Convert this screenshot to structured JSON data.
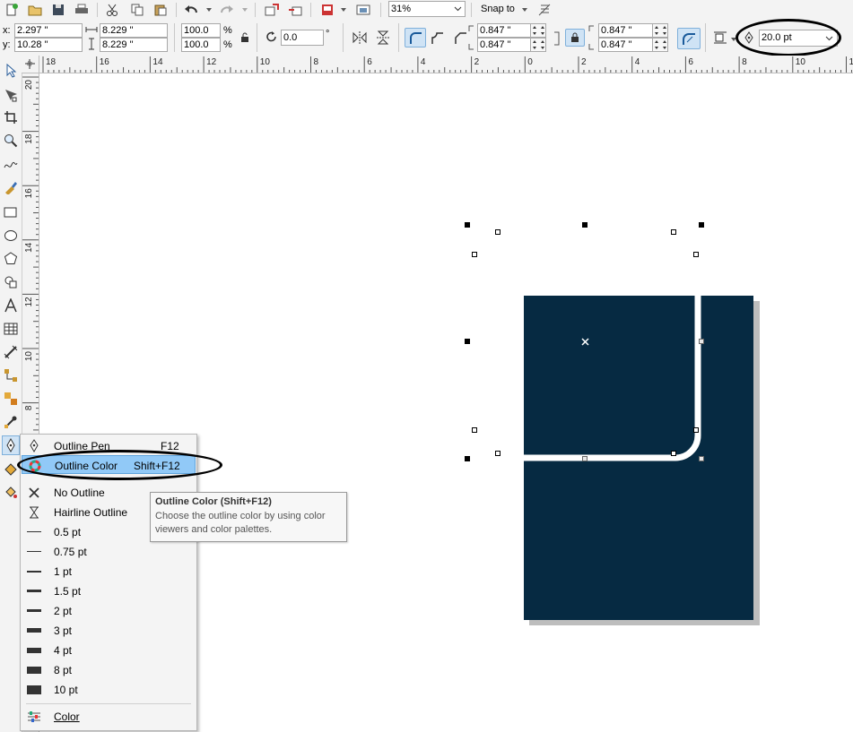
{
  "toolbar": {
    "zoom": "31%",
    "snap_to": "Snap to"
  },
  "property_bar": {
    "x_label": "x:",
    "x_value": "2.297 \"",
    "y_label": "y:",
    "y_value": "10.28 \"",
    "width_value": "8.229 \"",
    "height_value": "8.229 \"",
    "scale_x": "100.0",
    "scale_y": "100.0",
    "percent": "%",
    "rotation": "0.0",
    "degree": "°",
    "corner_tl": "0.847 \"",
    "corner_bl": "0.847 \"",
    "corner_tr": "0.847 \"",
    "corner_br": "0.847 \"",
    "outline_width": "20.0 pt"
  },
  "rulers": {
    "horizontal_ticks": [
      "18",
      "16",
      "14",
      "12",
      "10",
      "8",
      "6",
      "4",
      "2",
      "0",
      "2",
      "4",
      "6",
      "8",
      "10",
      "12"
    ],
    "vertical_ticks": [
      "20",
      "18",
      "16",
      "14",
      "12",
      "10",
      "8"
    ]
  },
  "flyout_menu": {
    "items": [
      {
        "label": "Outline Pen",
        "shortcut": "F12",
        "icon": "pen-nib-icon"
      },
      {
        "label": "Outline Color",
        "shortcut": "Shift+F12",
        "icon": "color-wheel-icon"
      },
      {
        "label": "No Outline",
        "shortcut": "",
        "icon": "x-icon"
      },
      {
        "label": "Hairline Outline",
        "shortcut": "",
        "icon": "hairline-icon"
      },
      {
        "label": "0.5 pt",
        "shortcut": "",
        "icon": "line-width-icon"
      },
      {
        "label": "0.75 pt",
        "shortcut": "",
        "icon": "line-width-icon"
      },
      {
        "label": "1 pt",
        "shortcut": "",
        "icon": "line-width-icon"
      },
      {
        "label": "1.5 pt",
        "shortcut": "",
        "icon": "line-width-icon"
      },
      {
        "label": "2 pt",
        "shortcut": "",
        "icon": "line-width-icon"
      },
      {
        "label": "3 pt",
        "shortcut": "",
        "icon": "line-width-icon"
      },
      {
        "label": "4 pt",
        "shortcut": "",
        "icon": "line-width-icon"
      },
      {
        "label": "8 pt",
        "shortcut": "",
        "icon": "line-width-icon"
      },
      {
        "label": "10 pt",
        "shortcut": "",
        "icon": "line-width-icon"
      },
      {
        "label": "Color",
        "shortcut": "",
        "icon": "color-settings-icon"
      }
    ],
    "highlighted_index": 1
  },
  "tooltip": {
    "title": "Outline Color (Shift+F12)",
    "line1": "Choose the outline color by using color",
    "line2": "viewers and color palettes."
  },
  "colors": {
    "shape_fill": "#062a42",
    "menu_highlight": "#91c9f7"
  }
}
